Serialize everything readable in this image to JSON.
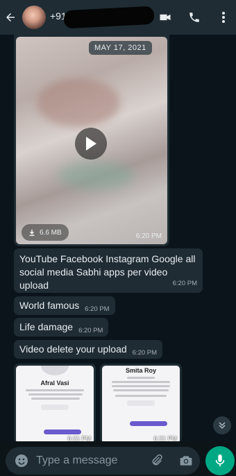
{
  "header": {
    "contact_name": "+91",
    "icons": [
      "back-arrow-icon",
      "video-call-icon",
      "voice-call-icon",
      "more-options-icon"
    ]
  },
  "messages": {
    "video": {
      "date_chip": "MAY 17, 2021",
      "size": "6.6 MB",
      "time": "6:20 PM"
    },
    "texts": [
      {
        "text": "YouTube Facebook Instagram Google all social media Sabhi apps per video upload",
        "time": "6:20 PM"
      },
      {
        "text": "World famous",
        "time": "6:20 PM"
      },
      {
        "text": "Life damage",
        "time": "6:20 PM"
      },
      {
        "text": "Video delete your upload",
        "time": "6:20 PM"
      }
    ],
    "images": [
      {
        "name": "Afral Vasi",
        "time": "6:21 PM"
      },
      {
        "name": "Smita Roy",
        "time": "6:21 PM"
      }
    ]
  },
  "input": {
    "placeholder": "Type a message"
  },
  "colors": {
    "header_bg": "#1f2c34",
    "chat_bg": "#0b141a",
    "bubble_bg": "#1f2c34",
    "accent": "#00a884"
  }
}
